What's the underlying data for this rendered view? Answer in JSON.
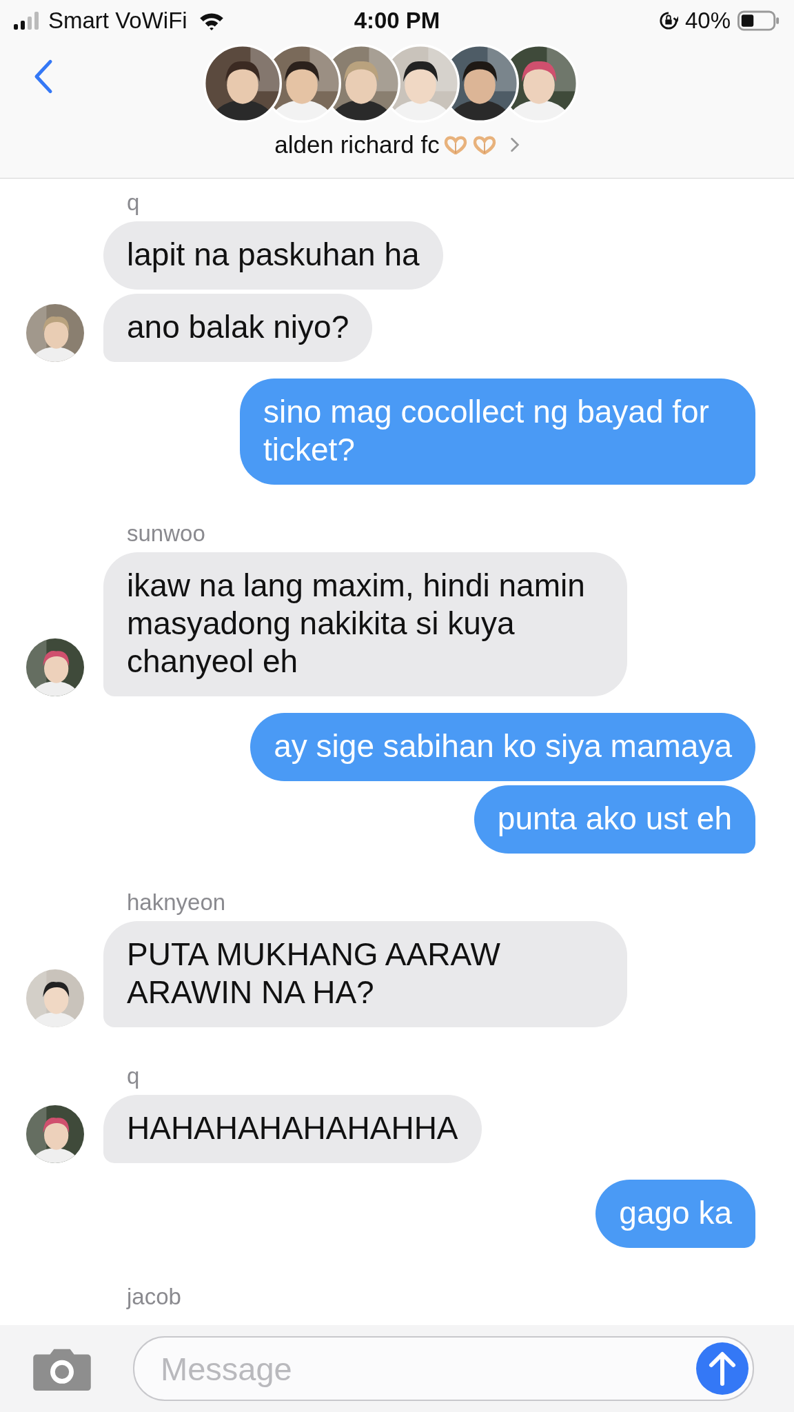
{
  "status_bar": {
    "carrier": "Smart VoWiFi",
    "time": "4:00 PM",
    "battery": "40%"
  },
  "header": {
    "title": "alden richard fc"
  },
  "messages": [
    {
      "kind": "name",
      "text": "q"
    },
    {
      "kind": "in",
      "text": "lapit na paskuhan ha",
      "tail": false
    },
    {
      "kind": "in",
      "text": "ano balak niyo?",
      "tail": true
    },
    {
      "kind": "out",
      "text": "sino mag cocollect ng bayad for ticket?",
      "tail": true
    },
    {
      "kind": "name",
      "text": "sunwoo"
    },
    {
      "kind": "in",
      "text": "ikaw na lang maxim, hindi namin masyadong nakikita si kuya chanyeol eh",
      "tail": true
    },
    {
      "kind": "out",
      "text": "ay sige sabihan ko siya mamaya",
      "tail": false
    },
    {
      "kind": "out",
      "text": "punta ako ust eh",
      "tail": true
    },
    {
      "kind": "name",
      "text": "haknyeon"
    },
    {
      "kind": "in",
      "text": "PUTA MUKHANG AARAW ARAWIN NA HA?",
      "tail": true
    },
    {
      "kind": "name",
      "text": "q"
    },
    {
      "kind": "in",
      "text": "HAHAHAHAHAHAHHA",
      "tail": true
    },
    {
      "kind": "out",
      "text": "gago ka",
      "tail": true
    },
    {
      "kind": "name",
      "text": "jacob"
    }
  ],
  "composer": {
    "placeholder": "Message"
  }
}
